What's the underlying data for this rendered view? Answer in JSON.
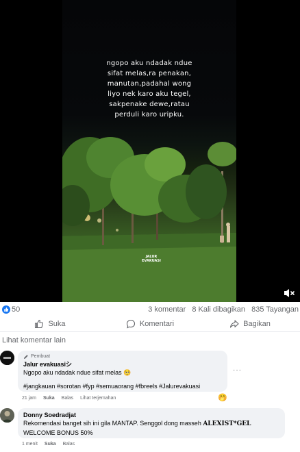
{
  "video": {
    "caption_lines": [
      "ngopo aku ndadak ndue",
      "sifat melas,ra penakan,",
      "manutan,padahal wong",
      "liyo nek karo aku tegel,",
      "sakpenake dewe,ratau",
      "perduli karo uripku."
    ],
    "watermark_line1": "JALUR",
    "watermark_line2": "EVAKUASI"
  },
  "stats": {
    "likes": "50",
    "comments": "3 komentar",
    "shares": "8 Kali dibagikan",
    "views": "835 Tayangan"
  },
  "actions": {
    "like": "Suka",
    "comment": "Komentari",
    "share": "Bagikan"
  },
  "more_comments": "Lihat komentar lain",
  "comments": [
    {
      "author_badge": "Pembuat",
      "name": "Jalur evakuasiシ",
      "text": "Ngopo aku ndadak ndue sifat melas 🥺",
      "hashtags": "#jangkauan #sorotan #fyp #semuaorang #fbreels #Jalurevakuasi",
      "time": "21 jam",
      "like": "Suka",
      "reply": "Balas",
      "translate": "Lihat terjemahan",
      "reaction": "🤭"
    },
    {
      "name": "Donny Soedradjat",
      "text_line1": "Rekomendasi banget sih ini gila MANTAP. Senggol dong masseh ",
      "text_brand": "ALEXIST*GEL",
      "text_line2": "WELCOME BONUS 50%",
      "time": "1 menit",
      "like": "Suka",
      "reply": "Balas"
    }
  ],
  "colors": {
    "accent": "#1877f2",
    "secondary_text": "#65676b",
    "bubble": "#f0f2f5"
  },
  "icons": [
    "like-icon",
    "comment-icon",
    "share-icon",
    "mute-icon",
    "more-icon",
    "pencil-icon"
  ]
}
